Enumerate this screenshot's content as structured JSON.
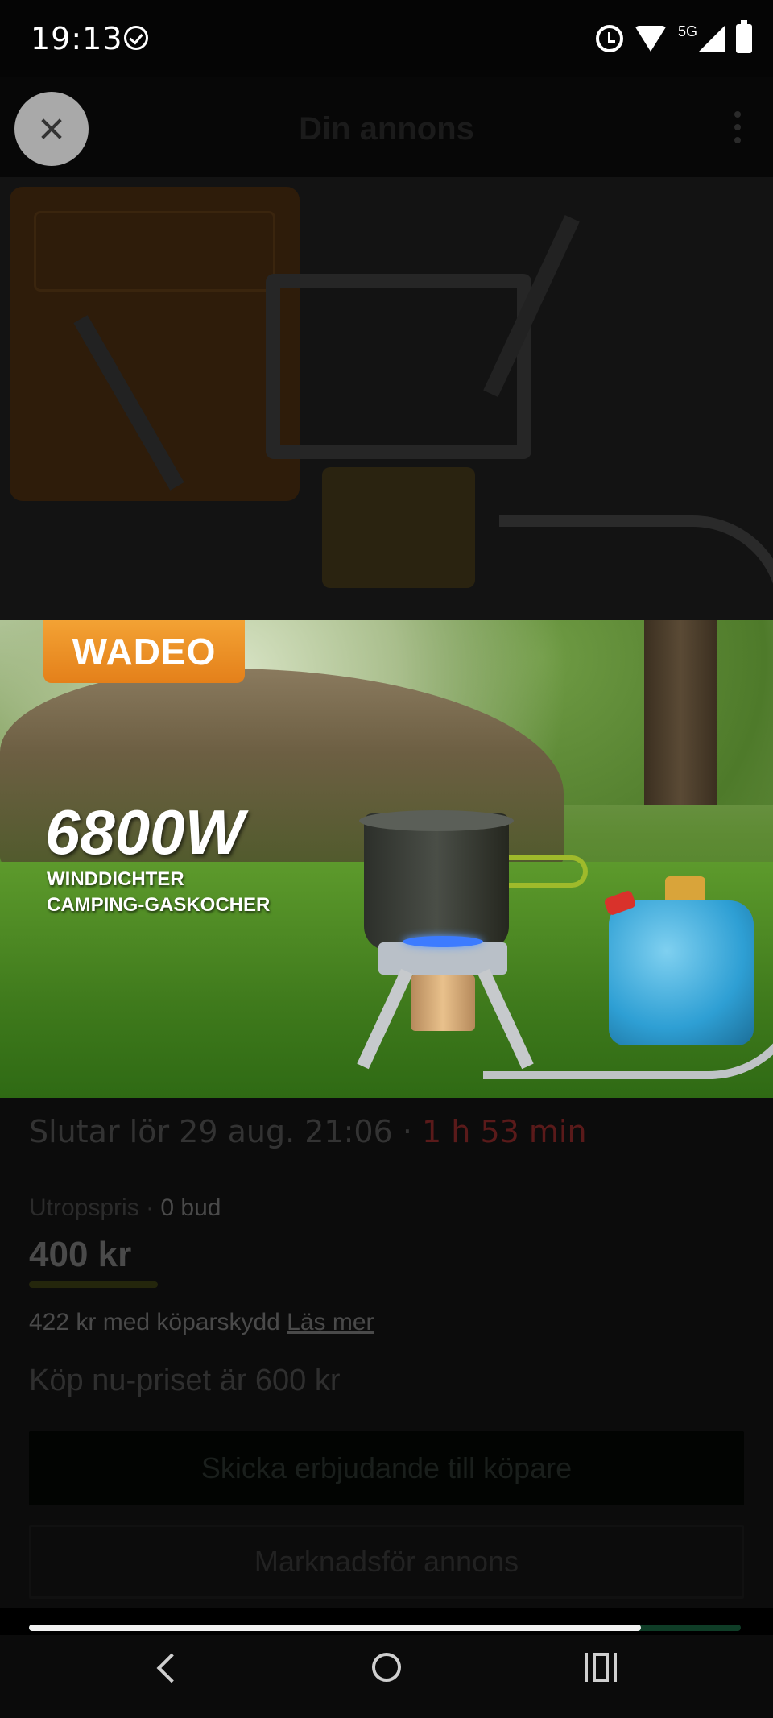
{
  "status_bar": {
    "time": "19:13",
    "network_type": "5G",
    "icons": [
      "check-circle-icon",
      "alarm-icon",
      "wifi-icon",
      "signal-icon",
      "battery-icon"
    ]
  },
  "header": {
    "title": "Din annons",
    "close_icon": "close-icon",
    "menu_icon": "more-vertical-icon"
  },
  "photo": {
    "brand": "WADEO",
    "headline": "6800W",
    "subline_1": "WINDDICHTER",
    "subline_2": "CAMPING-GASKOCHER"
  },
  "listing": {
    "ends_label": "Slutar lör 29 aug. 21:06",
    "separator": "·",
    "time_left": "1 h 53 min",
    "starting_price_label": "Utropspris",
    "bids_separator": "·",
    "bids": "0 bud",
    "price": "400 kr",
    "buyer_protection": "422 kr med köparskydd",
    "read_more": "Läs mer",
    "buy_now": "Köp nu-priset är 600 kr",
    "primary_button": "Skicka erbjudande till köpare",
    "secondary_button": "Marknadsför annons"
  },
  "pager": {
    "progress": 0.86
  },
  "colors": {
    "accent_green": "#0f3d27",
    "countdown_red": "#5a1a1a",
    "brand_orange": "#e4801a"
  },
  "nav_bar": {
    "icons": [
      "back-icon",
      "home-icon",
      "recents-icon"
    ]
  }
}
